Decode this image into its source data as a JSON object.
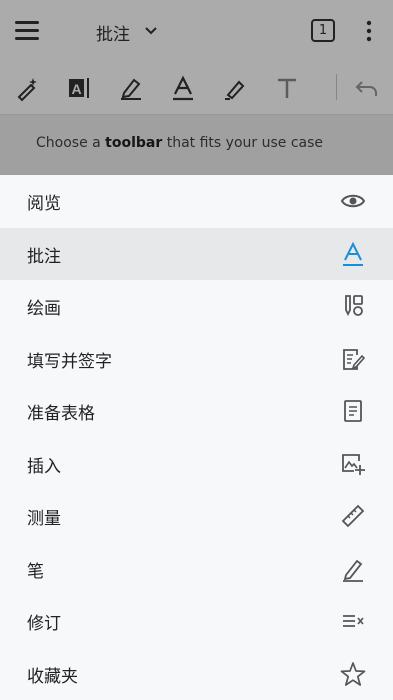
{
  "header": {
    "mode_title": "批注",
    "page_count": "1"
  },
  "hint": {
    "prefix": "Choose a ",
    "bold": "toolbar",
    "suffix": " that fits your use case"
  },
  "menu": {
    "items": [
      {
        "label": "阅览",
        "icon": "eye-icon"
      },
      {
        "label": "批注",
        "icon": "annotate-underline-a-icon",
        "selected": true
      },
      {
        "label": "绘画",
        "icon": "draw-shapes-icon"
      },
      {
        "label": "填写并签字",
        "icon": "fill-sign-icon"
      },
      {
        "label": "准备表格",
        "icon": "form-document-icon"
      },
      {
        "label": "插入",
        "icon": "insert-image-icon"
      },
      {
        "label": "测量",
        "icon": "ruler-icon"
      },
      {
        "label": "笔",
        "icon": "pen-icon"
      },
      {
        "label": "修订",
        "icon": "redline-list-icon"
      },
      {
        "label": "收藏夹",
        "icon": "star-icon"
      }
    ]
  },
  "colors": {
    "accent": "#1a8fd6",
    "selected_row": "#e6e8ea"
  }
}
